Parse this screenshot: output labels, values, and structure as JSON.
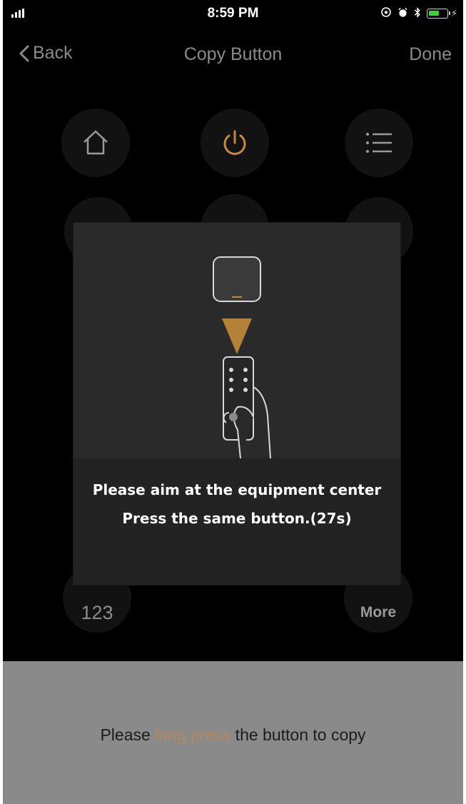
{
  "status_bar": {
    "time": "8:59 PM",
    "icons": [
      "signal-icon",
      "lock-rotation-icon",
      "alarm-icon",
      "bluetooth-icon",
      "battery-icon",
      "charging-icon"
    ]
  },
  "nav": {
    "back_label": "Back",
    "title": "Copy Button",
    "done_label": "Done"
  },
  "remote": {
    "buttons": [
      {
        "name": "home-icon"
      },
      {
        "name": "power-icon",
        "accent": "#c48a3a"
      },
      {
        "name": "menu-icon"
      }
    ],
    "numpad_label": "123",
    "more_label": "More"
  },
  "modal": {
    "line1": "Please aim at the equipment center",
    "line2": "Press the same button.(27s)",
    "illustration": [
      "device-icon",
      "ir-beam-icon",
      "remote-in-hand-icon"
    ]
  },
  "footer": {
    "hint_before": "Please ",
    "hint_accent": "long press",
    "hint_after": " the button to copy"
  },
  "colors": {
    "accent": "#c48a3a",
    "hint_accent": "#b6875a",
    "background": "#000000",
    "modal": "#232323",
    "sheet": "#8a8a8a"
  }
}
